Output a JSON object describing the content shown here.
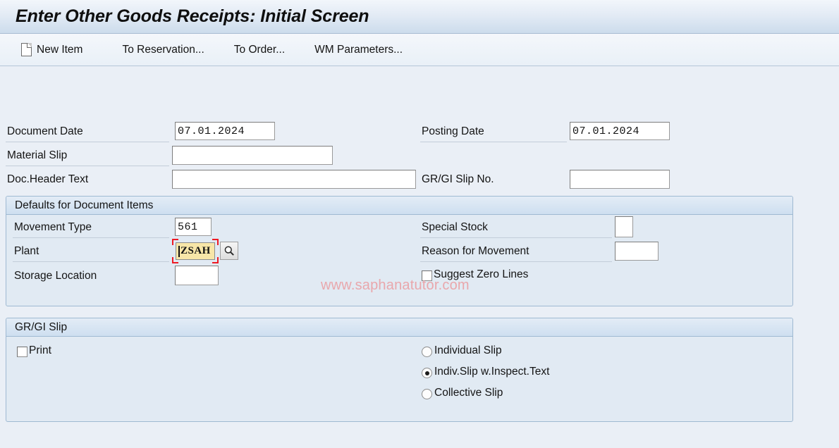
{
  "window": {
    "title": "Enter Other Goods Receipts: Initial Screen"
  },
  "toolbar": {
    "new_item_label": "New Item",
    "new_item_icon": "page-icon",
    "to_reservation_label": "To Reservation...",
    "to_order_label": "To Order...",
    "wm_parameters_label": "WM Parameters..."
  },
  "watermark": {
    "text": "www.saphanatutor.com",
    "color": "#e9a7ac"
  },
  "header_form": {
    "document_date": {
      "label": "Document Date",
      "value": "07.01.2024",
      "placeholder": ""
    },
    "posting_date": {
      "label": "Posting Date",
      "value": "07.01.2024",
      "placeholder": ""
    },
    "material_slip": {
      "label": "Material Slip",
      "value": "",
      "placeholder": ""
    },
    "doc_header_text": {
      "label": "Doc.Header Text",
      "value": "",
      "placeholder": ""
    },
    "gr_gi_slip_no": {
      "label": "GR/GI Slip No.",
      "value": "",
      "placeholder": ""
    }
  },
  "defaults_panel": {
    "title": "Defaults for Document Items",
    "movement_type": {
      "label": "Movement Type",
      "value": "561"
    },
    "plant": {
      "label": "Plant",
      "value": "ZSAH",
      "focused": true,
      "search_help_icon": "magnifier-icon",
      "highlight_color": "#f7e6a8",
      "focus_marker_color": "#ee1b24"
    },
    "storage_location": {
      "label": "Storage Location",
      "value": ""
    },
    "special_stock": {
      "label": "Special Stock",
      "value": ""
    },
    "reason_for_movement": {
      "label": "Reason for Movement",
      "value": ""
    },
    "suggest_zero_lines": {
      "label": "Suggest Zero Lines",
      "checked": false
    }
  },
  "slip_panel": {
    "title": "GR/GI Slip",
    "print": {
      "label": "Print",
      "checked": false
    },
    "slip_options": [
      {
        "label": "Individual Slip",
        "selected": false
      },
      {
        "label": "Indiv.Slip w.Inspect.Text",
        "selected": true
      },
      {
        "label": "Collective Slip",
        "selected": false
      }
    ]
  }
}
